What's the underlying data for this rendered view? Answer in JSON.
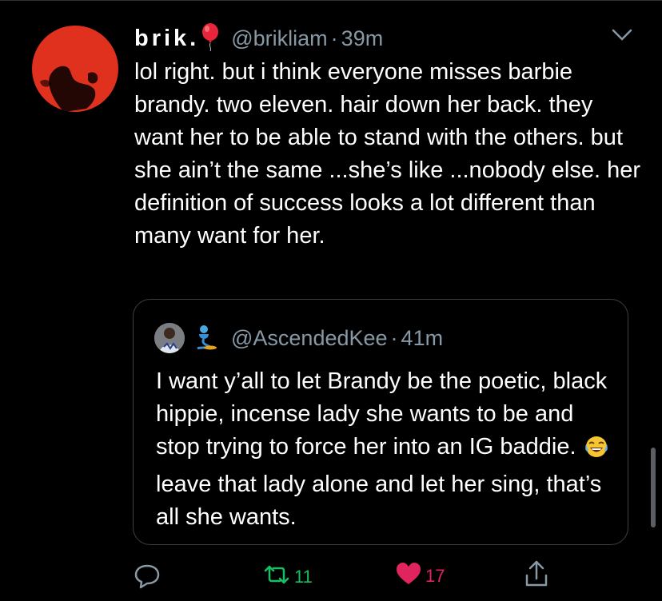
{
  "tweet": {
    "display_name": "brik.",
    "handle": "@brikliam",
    "time": "39m",
    "dot": "·",
    "text": "lol right. but i think everyone misses barbie brandy. two eleven. hair down her back. they want her to be able to stand with the others. but she ain’t the same ...she’s like ...nobody else. her definition of success looks a lot different than many want for her."
  },
  "quoted": {
    "handle": "@AscendedKee",
    "time": "41m",
    "dot": "·",
    "text_before_emoji": "I want y’all to let Brandy be the poetic, black hippie, incense lady she wants to be and stop trying to force her into an IG baddie.",
    "text_after_emoji": "leave that lady alone and let her sing, that’s all she wants."
  },
  "actions": {
    "retweet_count": "11",
    "like_count": "17"
  },
  "colors": {
    "accent_red": "#e0301e",
    "muted": "#8899a6",
    "retweet_green": "#17bf63",
    "like_pink": "#e0245e"
  }
}
